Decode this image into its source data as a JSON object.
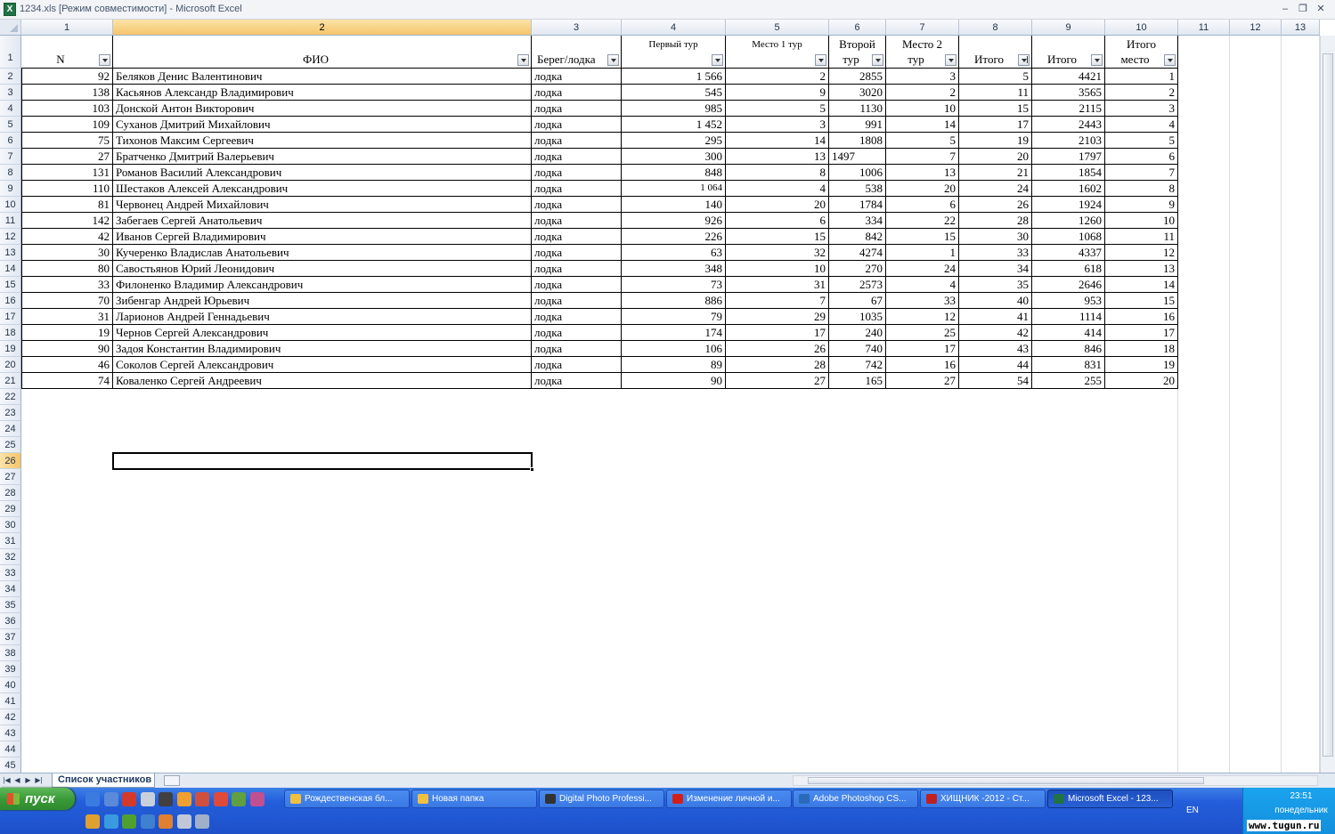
{
  "window": {
    "title": "1234.xls  [Режим совместимости] - Microsoft Excel"
  },
  "columns": [
    "1",
    "2",
    "3",
    "4",
    "5",
    "6",
    "7",
    "8",
    "9",
    "10",
    "11",
    "12",
    "13"
  ],
  "header": {
    "n": "N",
    "fio": "ФИО",
    "shore": "Берег/лодка",
    "tour1_l1": "Первый тур",
    "place1_l1": "Место 1 тур",
    "tour2_l1": "Второй",
    "tour2_l2": "тур",
    "place2_l1": "Место 2",
    "place2_l2": "тур",
    "total_places": "Итого",
    "total_sum": "Итого",
    "final_l1": "Итого",
    "final_l2": "место"
  },
  "rows": [
    {
      "n": "92",
      "fio": "Беляков Денис Валентинович",
      "shore": "лодка",
      "t1": "1 566",
      "p1": "2",
      "t2": "2855",
      "p2": "3",
      "sp": "5",
      "sum": "4421",
      "place": "1"
    },
    {
      "n": "138",
      "fio": "Касьянов Александр Владимирович",
      "shore": "лодка",
      "t1": "545",
      "p1": "9",
      "t2": "3020",
      "p2": "2",
      "sp": "11",
      "sum": "3565",
      "place": "2"
    },
    {
      "n": "103",
      "fio": "Донской Антон Викторович",
      "shore": "лодка",
      "t1": "985",
      "p1": "5",
      "t2": "1130",
      "p2": "10",
      "sp": "15",
      "sum": "2115",
      "place": "3"
    },
    {
      "n": "109",
      "fio": "Суханов Дмитрий Михайлович",
      "shore": "лодка",
      "t1": "1 452",
      "p1": "3",
      "t2": "991",
      "p2": "14",
      "sp": "17",
      "sum": "2443",
      "place": "4"
    },
    {
      "n": "75",
      "fio": "Тихонов Максим Сергеевич",
      "shore": "лодка",
      "t1": "295",
      "p1": "14",
      "t2": "1808",
      "p2": "5",
      "sp": "19",
      "sum": "2103",
      "place": "5"
    },
    {
      "n": "27",
      "fio": "Братченко Дмитрий Валерьевич",
      "shore": "лодка",
      "t1": "300",
      "p1": "13",
      "t2": "1497",
      "p2": "7",
      "sp": "20",
      "sum": "1797",
      "place": "6"
    },
    {
      "n": "131",
      "fio": "Романов Василий Александрович",
      "shore": "лодка",
      "t1": "848",
      "p1": "8",
      "t2": "1006",
      "p2": "13",
      "sp": "21",
      "sum": "1854",
      "place": "7"
    },
    {
      "n": "110",
      "fio": "Шестаков Алексей Александрович",
      "shore": "лодка",
      "t1": "1 064",
      "p1": "4",
      "t2": "538",
      "p2": "20",
      "sp": "24",
      "sum": "1602",
      "place": "8"
    },
    {
      "n": "81",
      "fio": "Червонец Андрей Михайлович",
      "shore": "лодка",
      "t1": "140",
      "p1": "20",
      "t2": "1784",
      "p2": "6",
      "sp": "26",
      "sum": "1924",
      "place": "9"
    },
    {
      "n": "142",
      "fio": "Забегаев Сергей Анатольевич",
      "shore": "лодка",
      "t1": "926",
      "p1": "6",
      "t2": "334",
      "p2": "22",
      "sp": "28",
      "sum": "1260",
      "place": "10"
    },
    {
      "n": "42",
      "fio": "Иванов Сергей Владимирович",
      "shore": "лодка",
      "t1": "226",
      "p1": "15",
      "t2": "842",
      "p2": "15",
      "sp": "30",
      "sum": "1068",
      "place": "11"
    },
    {
      "n": "30",
      "fio": "Кучеренко Владислав Анатольевич",
      "shore": "лодка",
      "t1": "63",
      "p1": "32",
      "t2": "4274",
      "p2": "1",
      "sp": "33",
      "sum": "4337",
      "place": "12"
    },
    {
      "n": "80",
      "fio": "Савостьянов Юрий Леонидович",
      "shore": "лодка",
      "t1": "348",
      "p1": "10",
      "t2": "270",
      "p2": "24",
      "sp": "34",
      "sum": "618",
      "place": "13"
    },
    {
      "n": "33",
      "fio": "Филоненко Владимир Александрович",
      "shore": "лодка",
      "t1": "73",
      "p1": "31",
      "t2": "2573",
      "p2": "4",
      "sp": "35",
      "sum": "2646",
      "place": "14"
    },
    {
      "n": "70",
      "fio": "Зибенгар Андрей Юрьевич",
      "shore": "лодка",
      "t1": "886",
      "p1": "7",
      "t2": "67",
      "p2": "33",
      "sp": "40",
      "sum": "953",
      "place": "15"
    },
    {
      "n": "31",
      "fio": "Ларионов Андрей Геннадьевич",
      "shore": "лодка",
      "t1": "79",
      "p1": "29",
      "t2": "1035",
      "p2": "12",
      "sp": "41",
      "sum": "1114",
      "place": "16"
    },
    {
      "n": "19",
      "fio": "Чернов Сергей Александрович",
      "shore": "лодка",
      "t1": "174",
      "p1": "17",
      "t2": "240",
      "p2": "25",
      "sp": "42",
      "sum": "414",
      "place": "17"
    },
    {
      "n": "90",
      "fio": "Задоя Константин Владимирович",
      "shore": "лодка",
      "t1": "106",
      "p1": "26",
      "t2": "740",
      "p2": "17",
      "sp": "43",
      "sum": "846",
      "place": "18"
    },
    {
      "n": "46",
      "fio": "Соколов Сергей Александрович",
      "shore": "лодка",
      "t1": "89",
      "p1": "28",
      "t2": "742",
      "p2": "16",
      "sp": "44",
      "sum": "831",
      "place": "19"
    },
    {
      "n": "74",
      "fio": "Коваленко Сергей Андреевич",
      "shore": "лодка",
      "t1": "90",
      "p1": "27",
      "t2": "165",
      "p2": "27",
      "sp": "54",
      "sum": "255",
      "place": "20"
    }
  ],
  "row_numbers": [
    "1",
    "2",
    "3",
    "4",
    "5",
    "6",
    "7",
    "8",
    "9",
    "10",
    "11",
    "12",
    "13",
    "14",
    "15",
    "16",
    "17",
    "18",
    "19",
    "20",
    "21",
    "22",
    "23",
    "24",
    "25",
    "26",
    "27",
    "28",
    "29",
    "30",
    "31",
    "32",
    "33",
    "34",
    "35",
    "36",
    "37",
    "38",
    "39",
    "40",
    "41",
    "42",
    "43",
    "44",
    "45"
  ],
  "selected": {
    "row": "26",
    "column": "2"
  },
  "sheet_tab": "Список участников",
  "taskbar": {
    "start": "пуск",
    "windows": [
      {
        "label": "Рождественская бл...",
        "icon_color": "#f0c040"
      },
      {
        "label": "Новая папка",
        "icon_color": "#f0c040"
      },
      {
        "label": "Digital Photo Professi...",
        "icon_color": "#333333"
      },
      {
        "label": "Изменение личной и...",
        "icon_color": "#d0201a"
      },
      {
        "label": "Adobe Photoshop CS...",
        "icon_color": "#2a6ab8"
      },
      {
        "label": "ХИЩНИК -2012 - Ст...",
        "icon_color": "#c02020"
      },
      {
        "label": "Microsoft Excel - 123...",
        "icon_color": "#217346"
      }
    ],
    "lang": "EN",
    "time": "23:51",
    "day": "понедельник"
  },
  "watermark": "www.tugun.ru"
}
